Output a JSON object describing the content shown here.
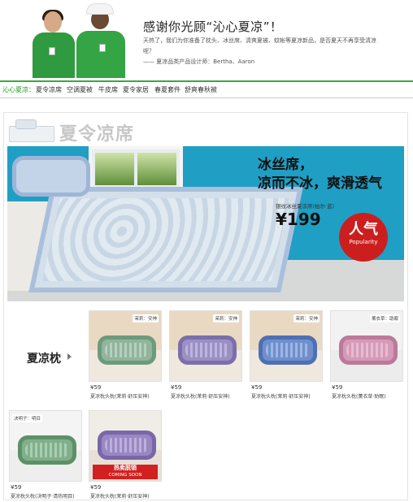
{
  "header": {
    "title": "感谢你光顾“沁心夏凉”！",
    "text": "天热了，我们为你准备了枕头、冰丝席、清爽夏被、蚊帐等夏凉新品，是否夏天不再享受清凉呢？",
    "signature": "—— 夏凉品类产品设计师：Bertha、Aaron"
  },
  "nav": {
    "items": [
      {
        "label": "沁心夏凉：",
        "active": true
      },
      {
        "label": "夏令凉席",
        "active": false
      },
      {
        "label": "空调夏被",
        "active": false
      },
      {
        "label": "牛皮席",
        "active": false
      },
      {
        "label": "夏令家居",
        "active": false
      },
      {
        "label": "春夏套件",
        "active": false
      },
      {
        "label": "舒爽春秋被",
        "active": false
      }
    ]
  },
  "section": {
    "title": "夏令凉席"
  },
  "banner": {
    "headline_line1": "冰丝席，",
    "headline_line2": "凉而不冰，爽滑透气",
    "product_name": "银纹冰丝夏凉席(柏尔·蓝)",
    "price": "¥199",
    "badge_big": "人气",
    "badge_small": "Popularity"
  },
  "pillows": {
    "label": "夏凉枕",
    "items": [
      {
        "price": "¥59",
        "name": "夏凉枕头枕(茉莉·舒压安神)",
        "tag": "茉莉：安神",
        "color": "#8fb59b",
        "sale": false
      },
      {
        "price": "¥59",
        "name": "夏凉枕头枕(茉莉·舒压安神)",
        "tag": "茉莉：安神",
        "color": "#9b8fc6",
        "sale": false
      },
      {
        "price": "¥59",
        "name": "夏凉枕头枕(茉莉·舒压安神)",
        "tag": "茉莉：安神",
        "color": "#6e8fcf",
        "sale": false
      },
      {
        "price": "¥59",
        "name": "夏凉枕头枕(薰衣草·助眠)",
        "tag": "薰衣草：助眠",
        "color": "#d69ab8",
        "sale": false
      },
      {
        "price": "¥59",
        "name": "夏凉枕头枕(决明子·清热明目)",
        "tag": "决明子：明目",
        "color": "#7fb08a",
        "sale": false
      },
      {
        "price": "¥59",
        "name": "夏凉枕头枕(茉莉·舒压安神)",
        "tag": "",
        "color": "#9a86c4",
        "sale": true,
        "sale_text": "热卖脱销",
        "sale_sub": "COMING SOON"
      }
    ]
  }
}
